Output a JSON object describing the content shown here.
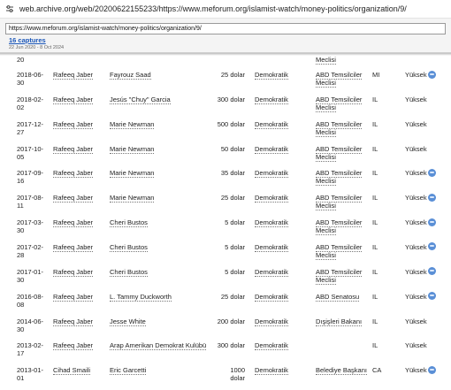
{
  "browser": {
    "address": "web.archive.org/web/20200622155233/https://www.meforum.org/islamist-watch/money-politics/organization/9/"
  },
  "wayback": {
    "url_input": "https://www.meforum.org/islamist-watch/money-politics/organization/9/",
    "captures": "16 captures",
    "range": "22 Jun 2020 - 8 Oct 2024"
  },
  "partial_row": {
    "date": "20",
    "office": "Meclisi"
  },
  "rows": [
    {
      "date": "2018-06-30",
      "donor": "Rafeeq Jaber",
      "recipient": "Fayrouz Saad",
      "amount": "25 dolar",
      "party": "Demokratik",
      "office1": "ABD Temsilciler",
      "office2": "Meclisi",
      "state": "MI",
      "level": "Yüksek",
      "badge": true
    },
    {
      "date": "2018-02-02",
      "donor": "Rafeeq Jaber",
      "recipient": "Jesús \"Chuy\" Garcia",
      "amount": "300 dolar",
      "party": "Demokratik",
      "office1": "ABD Temsilciler",
      "office2": "Meclisi",
      "state": "IL",
      "level": "Yüksek",
      "badge": false
    },
    {
      "date": "2017-12-27",
      "donor": "Rafeeq Jaber",
      "recipient": "Marie Newman",
      "amount": "500 dolar",
      "party": "Demokratik",
      "office1": "ABD Temsilciler",
      "office2": "Meclisi",
      "state": "IL",
      "level": "Yüksek",
      "badge": false
    },
    {
      "date": "2017-10-05",
      "donor": "Rafeeq Jaber",
      "recipient": "Marie Newman",
      "amount": "50 dolar",
      "party": "Demokratik",
      "office1": "ABD Temsilciler",
      "office2": "Meclisi",
      "state": "IL",
      "level": "Yüksek",
      "badge": false
    },
    {
      "date": "2017-09-16",
      "donor": "Rafeeq Jaber",
      "recipient": "Marie Newman",
      "amount": "35 dolar",
      "party": "Demokratik",
      "office1": "ABD Temsilciler",
      "office2": "Meclisi",
      "state": "IL",
      "level": "Yüksek",
      "badge": true
    },
    {
      "date": "2017-08-11",
      "donor": "Rafeeq Jaber",
      "recipient": "Marie Newman",
      "amount": "25 dolar",
      "party": "Demokratik",
      "office1": "ABD Temsilciler",
      "office2": "Meclisi",
      "state": "IL",
      "level": "Yüksek",
      "badge": true
    },
    {
      "date": "2017-03-30",
      "donor": "Rafeeq Jaber",
      "recipient": "Cheri Bustos",
      "amount": "5 dolar",
      "party": "Demokratik",
      "office1": "ABD Temsilciler",
      "office2": "Meclisi",
      "state": "IL",
      "level": "Yüksek",
      "badge": true
    },
    {
      "date": "2017-02-28",
      "donor": "Rafeeq Jaber",
      "recipient": "Cheri Bustos",
      "amount": "5 dolar",
      "party": "Demokratik",
      "office1": "ABD Temsilciler",
      "office2": "Meclisi",
      "state": "IL",
      "level": "Yüksek",
      "badge": true
    },
    {
      "date": "2017-01-30",
      "donor": "Rafeeq Jaber",
      "recipient": "Cheri Bustos",
      "amount": "5 dolar",
      "party": "Demokratik",
      "office1": "ABD Temsilciler",
      "office2": "Meclisi",
      "state": "IL",
      "level": "Yüksek",
      "badge": true
    },
    {
      "date": "2016-08-08",
      "donor": "Rafeeq Jaber",
      "recipient": "L. Tammy Duckworth",
      "amount": "25 dolar",
      "party": "Demokratik",
      "office1": "ABD Senatosu",
      "office2": "",
      "state": "IL",
      "level": "Yüksek",
      "badge": true
    },
    {
      "date": "2014-06-30",
      "donor": "Rafeeq Jaber",
      "recipient": "Jesse White",
      "amount": "200 dolar",
      "party": "Demokratik",
      "office1": "Dışişleri Bakanı",
      "office2": "",
      "state": "IL",
      "level": "Yüksek",
      "badge": false
    },
    {
      "date": "2013-02-17",
      "donor": "Rafeeq Jaber",
      "recipient": "Arap Amerikan Demokrat Kulübü",
      "amount": "300 dolar",
      "party": "Demokratik",
      "office1": "",
      "office2": "",
      "state": "IL",
      "level": "Yüksek",
      "badge": false
    },
    {
      "date": "2013-01-01",
      "donor": "Cihad Smaili",
      "recipient": "Eric Garcetti",
      "amount": "1000 dolar",
      "party": "Demokratik",
      "office1": "Belediye Başkanı",
      "office2": "",
      "state": "CA",
      "level": "Yüksek",
      "badge": true
    }
  ],
  "colors": {
    "link": "#1a56b8",
    "badge": "#5a8fd6"
  }
}
